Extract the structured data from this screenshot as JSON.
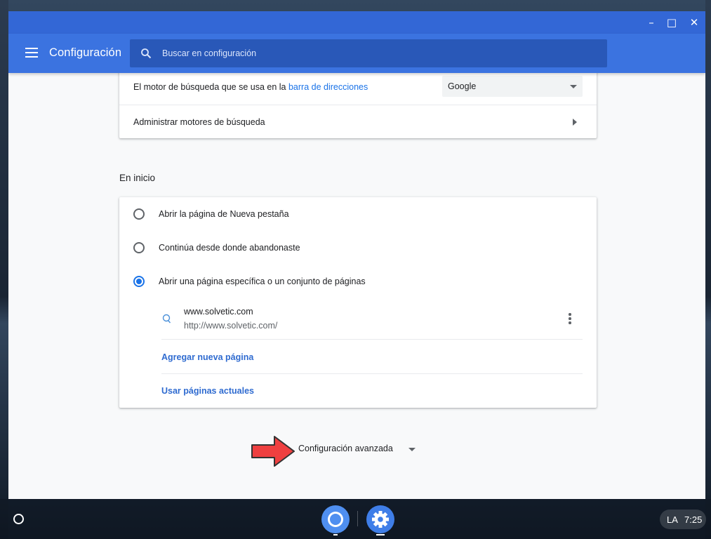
{
  "window": {
    "controls": {
      "minimize": "–",
      "maximize": "□",
      "close": "✕"
    }
  },
  "toolbar": {
    "menu_icon": "hamburger-menu-icon",
    "title": "Configuración",
    "search": {
      "icon": "search-icon",
      "placeholder": "Buscar en configuración",
      "value": ""
    }
  },
  "search_engine": {
    "label_prefix": "El motor de búsqueda que se usa en la ",
    "label_link": "barra de direcciones",
    "selected": "Google",
    "manage_label": "Administrar motores de búsqueda"
  },
  "on_startup": {
    "title": "En inicio",
    "options": [
      {
        "label": "Abrir la página de Nueva pestaña",
        "selected": false
      },
      {
        "label": "Continúa desde donde abandonaste",
        "selected": false
      },
      {
        "label": "Abrir una página específica o un conjunto de páginas",
        "selected": true
      }
    ],
    "pages": [
      {
        "title": "www.solvetic.com",
        "url": "http://www.solvetic.com/"
      }
    ],
    "add_page": "Agregar nueva página",
    "use_current": "Usar páginas actuales"
  },
  "advanced": {
    "label": "Configuración avanzada"
  },
  "shelf": {
    "apps": [
      "chrome-icon",
      "settings-icon"
    ],
    "lang": "LA",
    "time": "7:25"
  },
  "colors": {
    "titlebar": "#3367d6",
    "toolbar": "#3b73e0",
    "link": "#1a73e8",
    "arrow": "#ef4040"
  }
}
